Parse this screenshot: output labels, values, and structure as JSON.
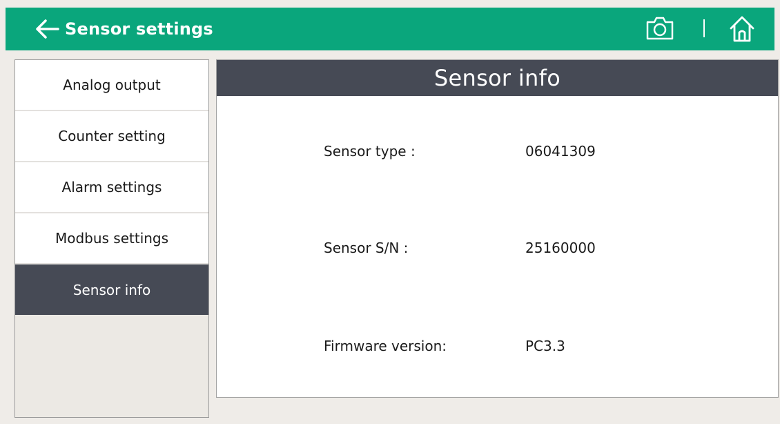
{
  "header": {
    "title": "Sensor settings",
    "back_icon": "arrow-left-icon",
    "camera_icon": "camera-icon",
    "home_icon": "home-icon",
    "bg_color": "#0aa67c"
  },
  "sidebar": {
    "items": [
      {
        "label": "Analog output",
        "active": false
      },
      {
        "label": "Counter setting",
        "active": false
      },
      {
        "label": "Alarm settings",
        "active": false
      },
      {
        "label": "Modbus settings",
        "active": false
      },
      {
        "label": "Sensor info",
        "active": true
      }
    ],
    "active_color": "#464a55"
  },
  "panel": {
    "title": "Sensor info",
    "rows": [
      {
        "label": "Sensor type :",
        "value": "06041309"
      },
      {
        "label": "Sensor S/N :",
        "value": "25160000"
      },
      {
        "label": "Firmware version:",
        "value": "PC3.3"
      }
    ]
  }
}
